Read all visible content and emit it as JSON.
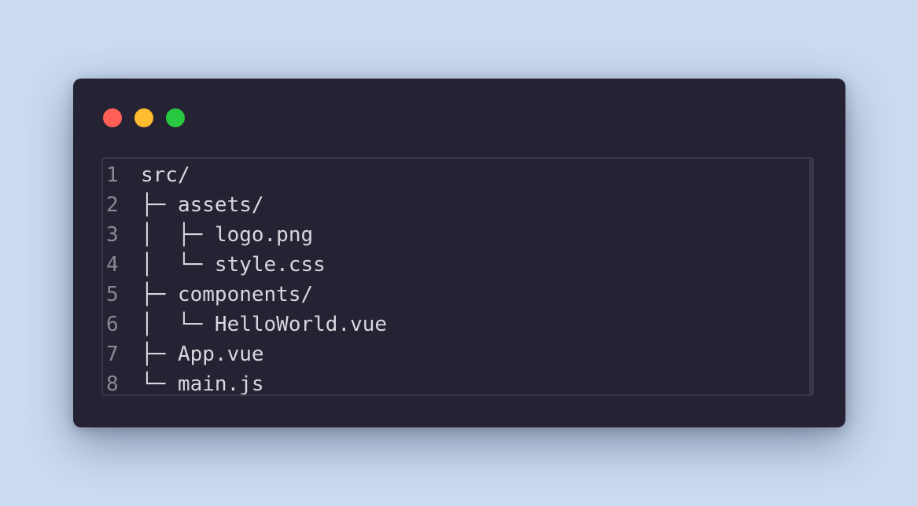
{
  "window": {
    "controls": [
      "close",
      "minimize",
      "maximize"
    ],
    "colors": {
      "close": "#ff5f57",
      "minimize": "#febc2e",
      "maximize": "#28c840",
      "background": "#252333"
    }
  },
  "code": {
    "lines": [
      {
        "number": "1",
        "text": "src/"
      },
      {
        "number": "2",
        "text": "├─ assets/"
      },
      {
        "number": "3",
        "text": "│  ├─ logo.png"
      },
      {
        "number": "4",
        "text": "│  └─ style.css"
      },
      {
        "number": "5",
        "text": "├─ components/"
      },
      {
        "number": "6",
        "text": "│  └─ HelloWorld.vue"
      },
      {
        "number": "7",
        "text": "├─ App.vue"
      },
      {
        "number": "8",
        "text": "└─ main.js"
      }
    ]
  }
}
